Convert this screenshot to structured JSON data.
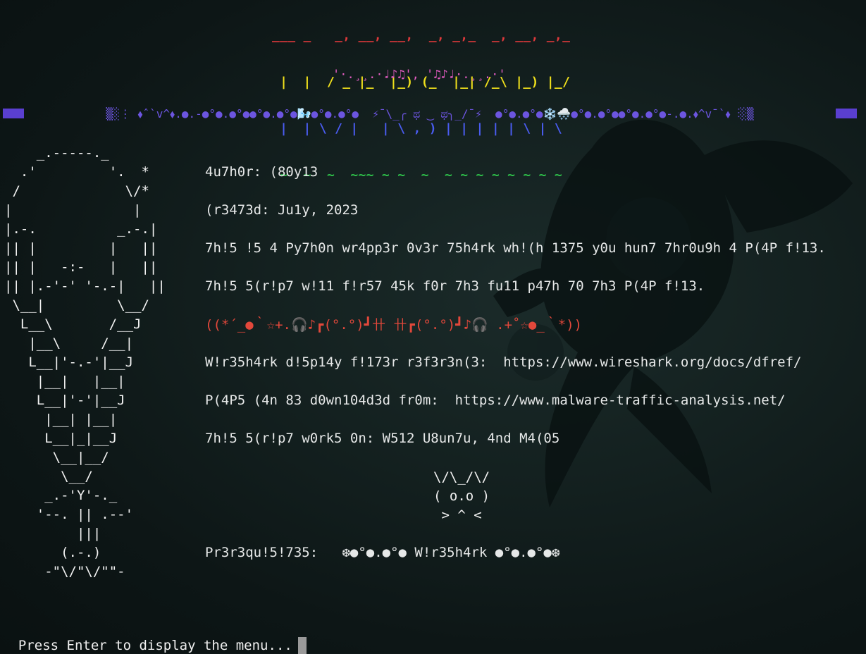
{
  "banner": {
    "line1": "___ _   _, __, __,  _, _,_  _, __, _,_",
    "line2": " |  |  / _ |_  |_) (_  |_| /_\\ |_) |_/",
    "line3": " |  | \\ / |   | \\ , ) | | | | | \\ | \\",
    "line4": " ~  ~  ~  ~~~ ~ ~  ~  ~ ~ ~ ~ ~ ~ ~ ~",
    "melody": "'·.¸¸.·♩♪♫', '♫♪♩·.¸¸.·'"
  },
  "border": {
    "text": "▒░⋮ ⬧ˆ`v^⬧.●.-●°●.●°●●°●.●°●🌬️●°●.●°●  ⚡¯\\_╭ ಥ ‿ ಥ╮_/¯⚡  ●°●.●°●❄️🌨️●°●.●°●●°●.●°●-.●.⬧^v¯`⬧ ⋮░▒",
    "color": "#5a3fd0"
  },
  "ascii_art": {
    "text": "    _.-----._\n  .'         '.  *\n /             \\/*\n|               |\n|.-.          _.-.|\n|| |         |   ||\n|| |   -:-   |   ||\n|| |.-'-' '-.-|   ||\n \\__|         \\__/\n  L__\\       /__J\n   |__\\     /__|\n   L__|'-.-'|__J\n    |__|   |__|\n    L__|'-'|__J\n     |__| |__|\n     L__|_|__J\n      \\__|__/\n       \\__/\n     _.-'Y'-._\n    '--. || .--'\n         |||\n       (.-.)\n     -\"\\/\"\\/\"\"-"
  },
  "info": {
    "author": "4u7h0r: (80y13",
    "created": "(r3473d: Ju1y, 2023",
    "description": "7h!5 !5 4 Py7h0n wr4pp3r 0v3r 75h4rk wh!(h 1375 y0u hun7 7hr0u9h 4 P(4P f!13.",
    "ask": "7h!5 5(r!p7 w!11 f!r57 45k f0r 7h3 fu11 p47h 70 7h3 P(4P f!13.",
    "kaomoji": "((*´_●｀☆+.🎧♪┏(°.°)┛卄 卄┏(°.°)┛♪🎧 .+˚☆●_｀*))",
    "filter_ref": "W!r35h4rk d!5p14y f!173r r3f3r3n(3:  https://www.wireshark.org/docs/dfref/",
    "pcap_source": "P(4P5 (4n 83 d0wn104d3d fr0m:  https://www.malware-traffic-analysis.net/",
    "platforms": "7h!5 5(r!p7 w0rk5 0n: W512 U8un7u, 4nd M4(05",
    "prereqs": "Pr3r3qu!5!735:   ❆●°●.●°● W!r35h4rk ●°●.●°●❆"
  },
  "cat": {
    "text": "\\/\\_/\\/\n( o.o )\n > ^ <"
  },
  "prompt": {
    "text": "Press Enter to display the menu..."
  },
  "colors": {
    "background": "#0d1616",
    "text": "#e6e8e8",
    "kaomoji": "#e2483b",
    "melody": "#e35cc2"
  }
}
